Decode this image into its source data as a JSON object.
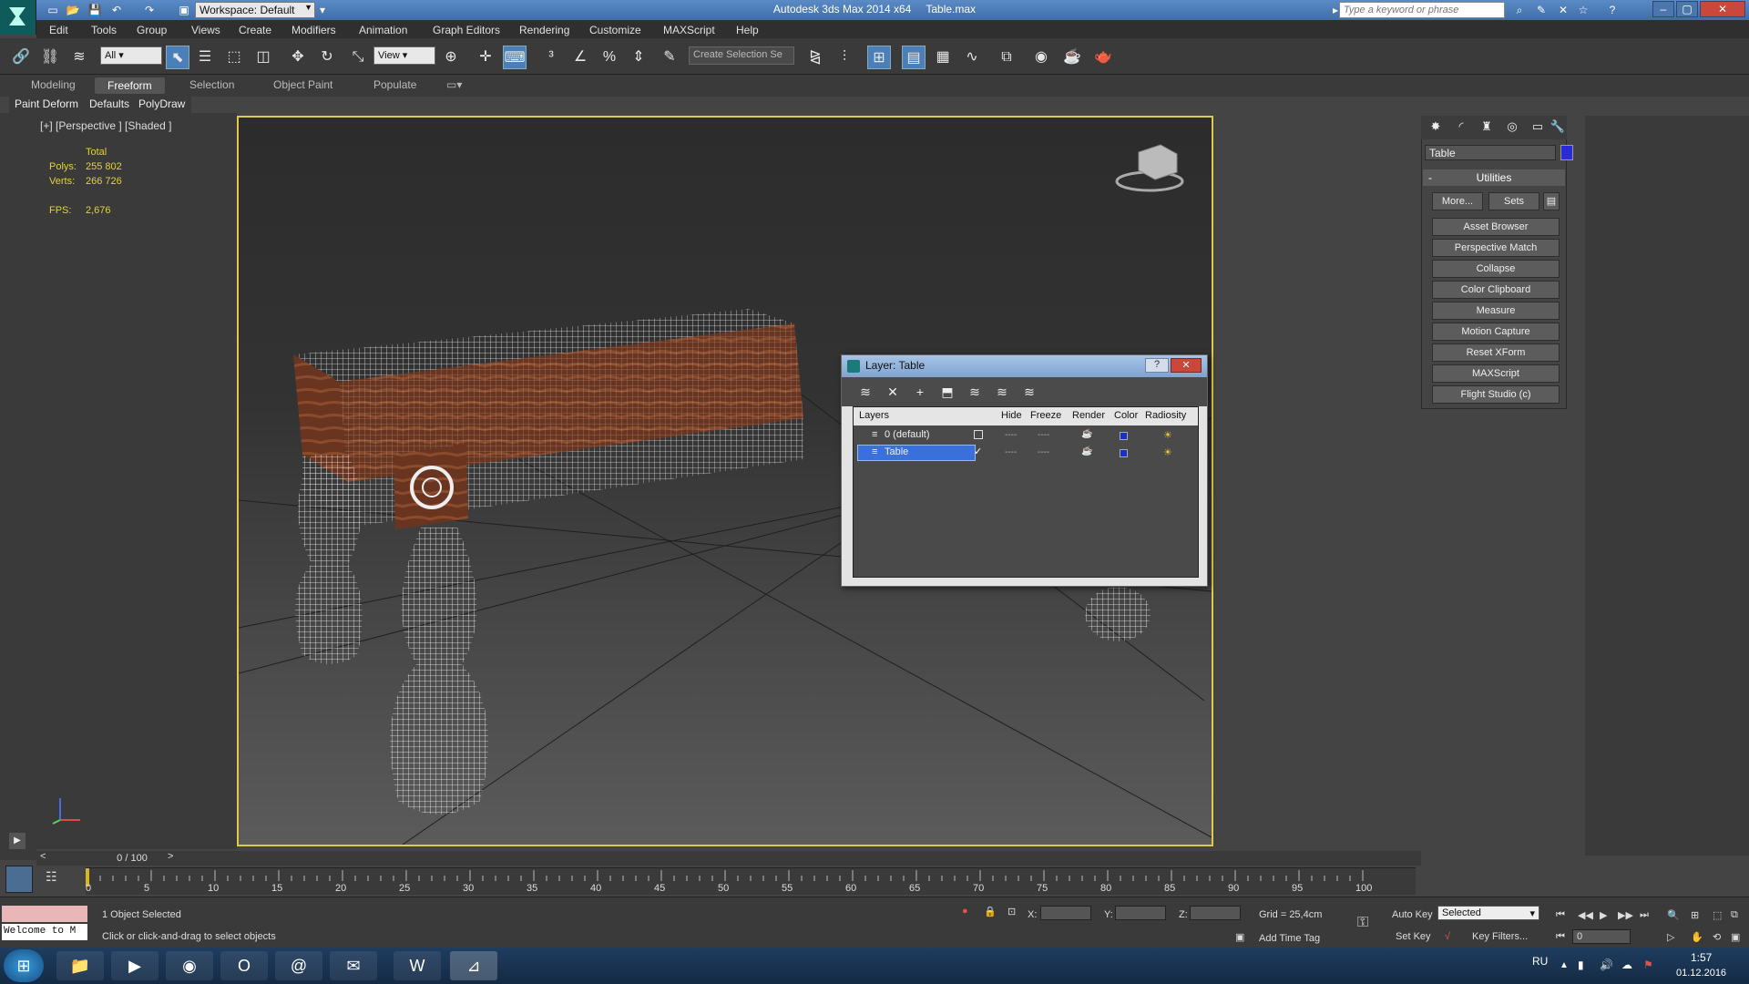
{
  "titlebar": {
    "workspace": "Workspace: Default",
    "app": "Autodesk 3ds Max  2014 x64",
    "file": "Table.max",
    "search_placeholder": "Type a keyword or phrase"
  },
  "menu": [
    "Edit",
    "Tools",
    "Group",
    "Views",
    "Create",
    "Modifiers",
    "Animation",
    "Graph Editors",
    "Rendering",
    "Customize",
    "MAXScript",
    "Help"
  ],
  "toolbar": {
    "filter": "All",
    "refcoord": "View",
    "selection_set": "Create Selection Se"
  },
  "ribbon": {
    "tabs": [
      "Modeling",
      "Freeform",
      "Selection",
      "Object Paint",
      "Populate"
    ],
    "active": "Freeform",
    "sub": [
      "Paint Deform",
      "Defaults",
      "PolyDraw"
    ]
  },
  "viewport": {
    "label": "[+] [Perspective ] [Shaded ]",
    "stats": {
      "total": "Total",
      "polys_label": "Polys:",
      "polys": "255 802",
      "verts_label": "Verts:",
      "verts": "266 726",
      "fps_label": "FPS:",
      "fps": "2,676"
    }
  },
  "command_panel": {
    "object_name": "Table",
    "object_color": "#2a2ad6",
    "rollout": "Utilities",
    "more": "More...",
    "sets": "Sets",
    "utilities": [
      "Asset Browser",
      "Perspective Match",
      "Collapse",
      "Color Clipboard",
      "Measure",
      "Motion Capture",
      "Reset XForm",
      "MAXScript",
      "Flight Studio (c)"
    ]
  },
  "layer_dialog": {
    "title": "Layer: Table",
    "help": "?",
    "columns": [
      "Layers",
      "Hide",
      "Freeze",
      "Render",
      "Color",
      "Radiosity"
    ],
    "rows": [
      {
        "name": "0 (default)",
        "color": "#1a2fc8"
      },
      {
        "name": "Table",
        "color": "#1a2fc8"
      }
    ]
  },
  "timeline": {
    "frame": "0 / 100",
    "ticks": [
      "0",
      "5",
      "10",
      "15",
      "20",
      "25",
      "30",
      "35",
      "40",
      "45",
      "50",
      "55",
      "60",
      "65",
      "70",
      "75",
      "80",
      "85",
      "90",
      "95",
      "100"
    ]
  },
  "status": {
    "selected": "1 Object Selected",
    "prompt": "Click or click-and-drag to select objects",
    "listener": "Welcome to M",
    "x": "X:",
    "y": "Y:",
    "z": "Z:",
    "grid": "Grid = 25,4cm",
    "add_time_tag": "Add Time Tag",
    "auto_key": "Auto Key",
    "set_key": "Set Key",
    "key_mode": "Selected",
    "key_filters": "Key Filters...",
    "frame_field": "0"
  },
  "tray": {
    "lang": "RU",
    "time": "1:57",
    "date": "01.12.2016"
  }
}
